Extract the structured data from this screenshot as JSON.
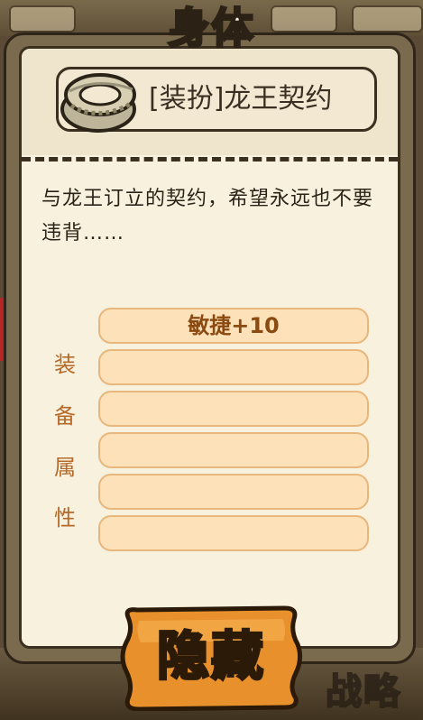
{
  "panel": {
    "title": "身体",
    "item": {
      "name": "[装扮]龙王契约",
      "icon": "ring-bracelet-icon"
    },
    "description": "与龙王订立的契约，希望永远也不要违背……",
    "attributes_label": [
      "装",
      "备",
      "属",
      "性"
    ],
    "attributes": [
      "敏捷+10",
      "",
      "",
      "",
      "",
      ""
    ]
  },
  "hide_button": {
    "label": "隐藏"
  },
  "background": {
    "bottom_text": "战略"
  },
  "colors": {
    "panel_frame": "#7a6a4e",
    "panel_paper": "#f8f1de",
    "attr_fill": "#fde1b8",
    "attr_text": "#8b4a12",
    "button": "#e8902b"
  }
}
